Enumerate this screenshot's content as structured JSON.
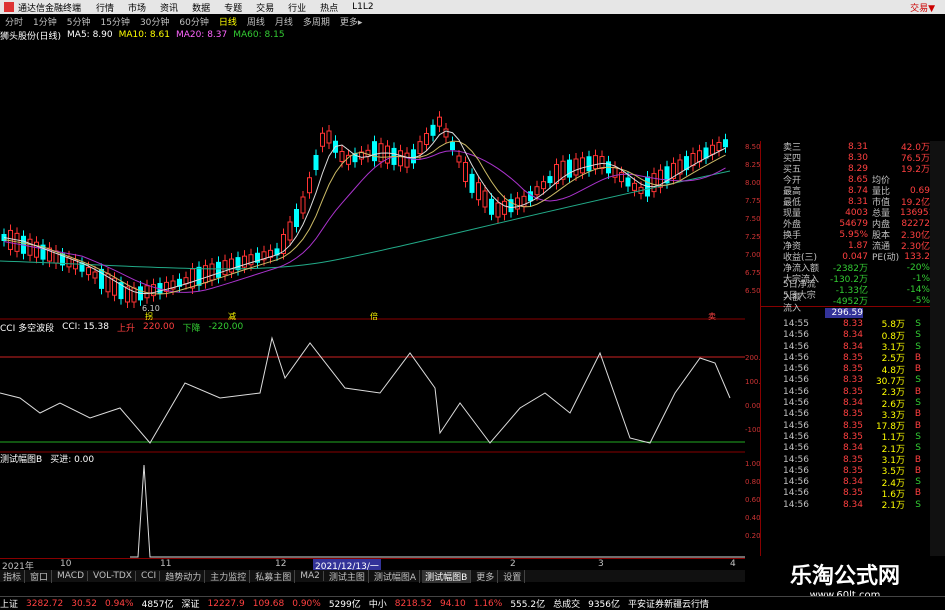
{
  "menubar": {
    "title": "通达信金融终端",
    "items": [
      "行情",
      "市场",
      "资讯",
      "数据",
      "专题",
      "交易",
      "行业",
      "热点",
      "L1L2"
    ],
    "right": "交易▼"
  },
  "toolbar": {
    "items": [
      "分时",
      "1分钟",
      "5分钟",
      "15分钟",
      "30分钟",
      "60分钟",
      "日线",
      "周线",
      "月线",
      "多周期",
      "更多▸"
    ],
    "active": "日线"
  },
  "ma_row": {
    "stock": "狮头股份(日线)",
    "ma5": "MA5: 8.90",
    "ma10": "MA10: 8.61",
    "ma20": "MA20: 8.37",
    "ma60": "MA60: 8.15"
  },
  "main_chart": {
    "low_label": "6.10",
    "markers": [
      "拐",
      "减",
      "倍",
      "卖"
    ]
  },
  "cci_bar": {
    "name": "CCI 多空波段",
    "value": "CCI: 15.38",
    "up": "上升",
    "up_val": "220.00",
    "down": "下降",
    "down_val": "-220.00"
  },
  "last_bar": {
    "name": "测试幅图B",
    "label": "买进: 0.00"
  },
  "x_axis": {
    "labels": [
      "2021年",
      "10",
      "11",
      "12",
      "2021/12/13/一",
      "2",
      "3",
      "4"
    ]
  },
  "indicator_tabs": [
    "指标",
    "窗口",
    "MACD",
    "VOL-TDX",
    "CCI",
    "趋势动力",
    "主力监控",
    "私募主图",
    "MA2",
    "测试主图",
    "测试幅图A",
    "测试幅图B",
    "更多",
    "设置"
  ],
  "right_quote": [
    {
      "l": "卖三",
      "v": "8.31",
      "l2": "",
      "v2": "42.0万"
    },
    {
      "l": "买四",
      "v": "8.30",
      "l2": "",
      "v2": "76.5万"
    },
    {
      "l": "买五",
      "v": "8.29",
      "l2": "",
      "v2": "19.2万"
    },
    {
      "l": "今开",
      "v": "8.65",
      "l2": "均价",
      "v2": ""
    },
    {
      "l": "最高",
      "v": "8.74",
      "l2": "量比",
      "v2": "0.69"
    },
    {
      "l": "最低",
      "v": "8.31",
      "l2": "市值",
      "v2": "19.2亿"
    },
    {
      "l": "现量",
      "v": "4003",
      "l2": "总量",
      "v2": "136951"
    },
    {
      "l": "外盘",
      "v": "54679",
      "l2": "内盘",
      "v2": "82272"
    },
    {
      "l": "换手",
      "v": "5.95%",
      "l2": "股本",
      "v2": "2.30亿"
    },
    {
      "l": "净资",
      "v": "1.87",
      "l2": "流通",
      "v2": "2.30亿"
    },
    {
      "l": "收益(三)",
      "v": "0.047",
      "l2": "PE(动)",
      "v2": "133.2"
    },
    {
      "l": "净流入额",
      "v": "-2382万",
      "l2": "",
      "v2": "-20%"
    },
    {
      "l": "大宗流入",
      "v": "-130.2万",
      "l2": "",
      "v2": "-1%"
    },
    {
      "l": "5日净流入额",
      "v": "-1.33亿",
      "l2": "",
      "v2": "-14%"
    },
    {
      "l": "5日大宗流入",
      "v": "-4952万",
      "l2": "",
      "v2": "-5%"
    }
  ],
  "ticks_header": "296.59",
  "ticks": [
    {
      "t": "14:55",
      "p": "8.33",
      "v": "5.8万",
      "s": "S"
    },
    {
      "t": "14:56",
      "p": "8.34",
      "v": "0.8万",
      "s": "S"
    },
    {
      "t": "14:56",
      "p": "8.34",
      "v": "3.1万",
      "s": "S"
    },
    {
      "t": "14:56",
      "p": "8.35",
      "v": "2.5万",
      "s": "B"
    },
    {
      "t": "14:56",
      "p": "8.35",
      "v": "4.8万",
      "s": "B"
    },
    {
      "t": "14:56",
      "p": "8.33",
      "v": "30.7万",
      "s": "S"
    },
    {
      "t": "14:56",
      "p": "8.35",
      "v": "2.3万",
      "s": "B"
    },
    {
      "t": "14:56",
      "p": "8.34",
      "v": "2.6万",
      "s": "S"
    },
    {
      "t": "14:56",
      "p": "8.35",
      "v": "3.3万",
      "s": "B"
    },
    {
      "t": "14:56",
      "p": "8.35",
      "v": "17.8万",
      "s": "B"
    },
    {
      "t": "14:56",
      "p": "8.35",
      "v": "1.1万",
      "s": "S"
    },
    {
      "t": "14:56",
      "p": "8.34",
      "v": "2.1万",
      "s": "S"
    },
    {
      "t": "14:56",
      "p": "8.35",
      "v": "3.1万",
      "s": "B"
    },
    {
      "t": "14:56",
      "p": "8.35",
      "v": "3.5万",
      "s": "B"
    },
    {
      "t": "14:56",
      "p": "8.34",
      "v": "2.4万",
      "s": "S"
    },
    {
      "t": "14:56",
      "p": "8.35",
      "v": "1.6万",
      "s": "B"
    },
    {
      "t": "14:56",
      "p": "8.34",
      "v": "2.1万",
      "s": "S"
    }
  ],
  "y_axis_main": [
    "8.50",
    "8.25",
    "8.00",
    "7.75",
    "7.50",
    "7.25",
    "7.00",
    "6.75",
    "6.50"
  ],
  "y_axis_cci": [
    "200.0",
    "100.0",
    "0.00",
    "-100.0"
  ],
  "y_axis_last": [
    "1.00",
    "0.80",
    "0.60",
    "0.40",
    "0.20"
  ],
  "bottom": {
    "sh_label": "上证",
    "sh": "3282.72",
    "sh_chg": "30.52",
    "sh_pct": "0.94%",
    "sh_amt": "4857亿",
    "sz_label": "深证",
    "sz": "12227.9",
    "sz_chg": "109.68",
    "sz_pct": "0.90%",
    "sz_amt": "5299亿",
    "zx_label": "中小",
    "zx": "8218.52",
    "zx_chg": "94.10",
    "zx_pct": "1.16%",
    "zx_amt": "555.2亿",
    "cj_label": "总成交",
    "cj": "9356亿",
    "broker": "平安证券新疆云行情"
  },
  "watermark": {
    "cn": "乐淘公式网",
    "url": "www.60lt.com"
  }
}
